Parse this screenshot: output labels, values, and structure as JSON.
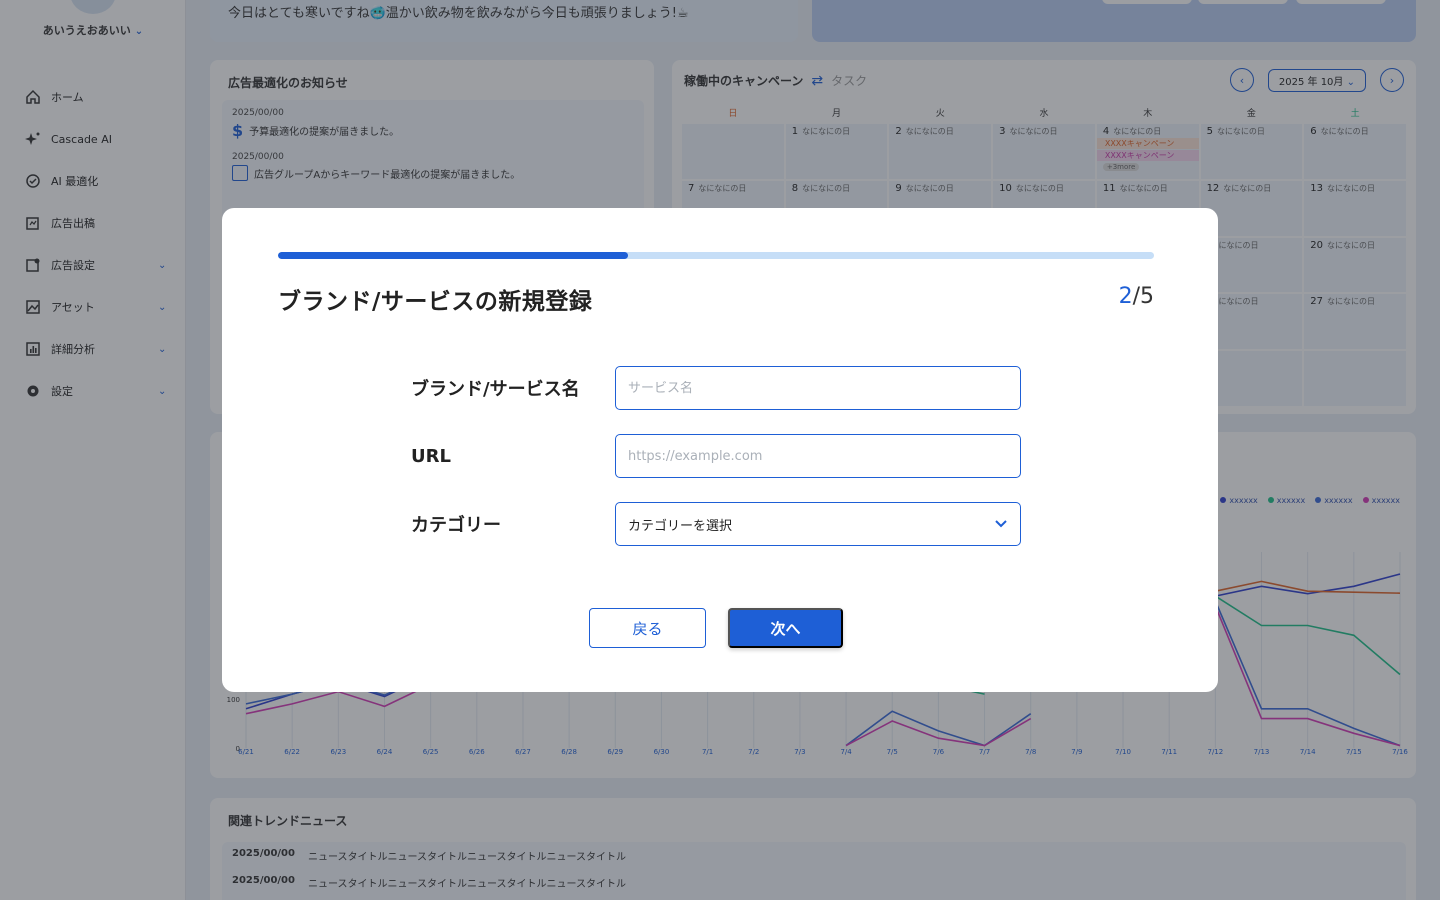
{
  "sidebar": {
    "username": "あいうえおあいい",
    "items": [
      {
        "label": "ホーム",
        "icon": "home-icon",
        "expandable": false
      },
      {
        "label": "Cascade AI",
        "icon": "sparkle-icon",
        "expandable": false
      },
      {
        "label": "AI 最適化",
        "icon": "ai-optimize-icon",
        "expandable": false
      },
      {
        "label": "広告出稿",
        "icon": "ad-publish-icon",
        "expandable": false
      },
      {
        "label": "広告設定",
        "icon": "ad-settings-icon",
        "expandable": true
      },
      {
        "label": "アセット",
        "icon": "image-icon",
        "expandable": true
      },
      {
        "label": "詳細分析",
        "icon": "analytics-icon",
        "expandable": true
      },
      {
        "label": "設定",
        "icon": "gear-icon",
        "expandable": true
      }
    ]
  },
  "banner": {
    "message": "今日はとても寒いですね🥶温かい飲み物を飲みながら今日も頑張りましょう!☕"
  },
  "notice": {
    "title": "広告最適化のお知らせ",
    "items": [
      {
        "date": "2025/00/00",
        "text": "予算最適化の提案が届きました。",
        "icon": "dollar-icon"
      },
      {
        "date": "2025/00/00",
        "text": "広告グループAからキーワード最適化の提案が届きました。",
        "icon": "list-icon"
      }
    ]
  },
  "calendar": {
    "title": "稼働中のキャンペーン",
    "task_label": "タスク",
    "month": "2025 年 10月",
    "weekdays": [
      "日",
      "月",
      "火",
      "水",
      "木",
      "金",
      "土"
    ],
    "weeks": [
      [
        {
          "d": "",
          "t": ""
        },
        {
          "d": "1",
          "t": "なになにの日"
        },
        {
          "d": "2",
          "t": "なになにの日"
        },
        {
          "d": "3",
          "t": "なになにの日"
        },
        {
          "d": "4",
          "t": "なになにの日"
        },
        {
          "d": "5",
          "t": "なになにの日"
        },
        {
          "d": "6",
          "t": "なになにの日"
        }
      ],
      [
        {
          "d": "7",
          "t": "なになにの日"
        },
        {
          "d": "8",
          "t": "なになにの日"
        },
        {
          "d": "9",
          "t": "なになにの日"
        },
        {
          "d": "10",
          "t": "なになにの日"
        },
        {
          "d": "11",
          "t": "なになにの日"
        },
        {
          "d": "12",
          "t": "なになにの日"
        },
        {
          "d": "13",
          "t": "なになにの日"
        }
      ],
      [
        {
          "d": "",
          "t": ""
        },
        {
          "d": "",
          "t": ""
        },
        {
          "d": "",
          "t": ""
        },
        {
          "d": "",
          "t": ""
        },
        {
          "d": "",
          "t": ""
        },
        {
          "d": "",
          "t": "なになにの日"
        },
        {
          "d": "20",
          "t": "なになにの日"
        }
      ],
      [
        {
          "d": "",
          "t": ""
        },
        {
          "d": "",
          "t": ""
        },
        {
          "d": "",
          "t": ""
        },
        {
          "d": "",
          "t": ""
        },
        {
          "d": "",
          "t": ""
        },
        {
          "d": "",
          "t": "なになにの日"
        },
        {
          "d": "27",
          "t": "なになにの日"
        }
      ],
      [
        {
          "d": "",
          "t": ""
        },
        {
          "d": "",
          "t": ""
        },
        {
          "d": "",
          "t": ""
        },
        {
          "d": "",
          "t": ""
        },
        {
          "d": "",
          "t": ""
        },
        {
          "d": "",
          "t": ""
        },
        {
          "d": "",
          "t": ""
        }
      ]
    ],
    "events": [
      "XXXXキャンペーン",
      "XXXXキャンペーン"
    ],
    "more": "+3more"
  },
  "chart_data": {
    "type": "line",
    "x": [
      "6/21",
      "6/22",
      "6/23",
      "6/24",
      "6/25",
      "6/26",
      "6/27",
      "6/28",
      "6/29",
      "6/30",
      "7/1",
      "7/2",
      "7/3",
      "7/4",
      "7/5",
      "7/6",
      "7/7",
      "7/8",
      "7/9",
      "7/10",
      "7/11",
      "7/12",
      "7/13",
      "7/14",
      "7/15",
      "7/16"
    ],
    "y_ticks": [
      "0",
      "100"
    ],
    "legend": [
      "xxxxxx",
      "xxxxxx",
      "xxxxxx",
      "xxxxxx"
    ],
    "series": [
      {
        "color": "#2f3fd0",
        "values": [
          80,
          110,
          135,
          105,
          150,
          175,
          null,
          null,
          null,
          null,
          null,
          null,
          null,
          null,
          null,
          null,
          null,
          null,
          null,
          null,
          null,
          310,
          330,
          315,
          330,
          355
        ]
      },
      {
        "color": "#1fc08a",
        "values": [
          null,
          null,
          null,
          235,
          260,
          null,
          null,
          null,
          null,
          null,
          null,
          null,
          170,
          120,
          150,
          130,
          110,
          null,
          null,
          null,
          null,
          310,
          250,
          250,
          230,
          150
        ]
      },
      {
        "color": "#3a6ad8",
        "values": [
          90,
          110,
          135,
          108,
          150,
          175,
          null,
          null,
          null,
          null,
          null,
          null,
          null,
          5,
          75,
          35,
          5,
          70,
          null,
          null,
          null,
          300,
          80,
          80,
          40,
          5
        ]
      },
      {
        "color": "#d43ab8",
        "values": [
          70,
          90,
          115,
          85,
          130,
          160,
          null,
          null,
          null,
          null,
          null,
          null,
          null,
          5,
          55,
          20,
          5,
          60,
          null,
          null,
          null,
          290,
          60,
          60,
          30,
          5
        ]
      },
      {
        "color": "#e0642a",
        "values": [
          null,
          null,
          null,
          null,
          null,
          null,
          null,
          null,
          null,
          null,
          null,
          null,
          null,
          null,
          null,
          null,
          null,
          null,
          null,
          null,
          null,
          320,
          340,
          320,
          318,
          316
        ]
      }
    ],
    "ylim": [
      0,
      400
    ]
  },
  "news": {
    "title": "関連トレンドニュース",
    "rows": [
      {
        "date": "2025/00/00",
        "text": "ニュースタイトルニュースタイトルニュースタイトルニュースタイトル"
      },
      {
        "date": "2025/00/00",
        "text": "ニュースタイトルニュースタイトルニュースタイトルニュースタイトル"
      }
    ]
  },
  "modal": {
    "title": "ブランド/サービスの新規登録",
    "step_current": "2",
    "step_total": "/5",
    "progress": 0.4,
    "fields": {
      "name_label": "ブランド/サービス名",
      "name_placeholder": "サービス名",
      "url_label": "URL",
      "url_placeholder": "https://example.com",
      "category_label": "カテゴリー",
      "category_value": "カテゴリーを選択"
    },
    "back_label": "戻る",
    "next_label": "次へ"
  },
  "colors": {
    "accent": "#1e5fd6",
    "progress_track": "#c6def7"
  }
}
